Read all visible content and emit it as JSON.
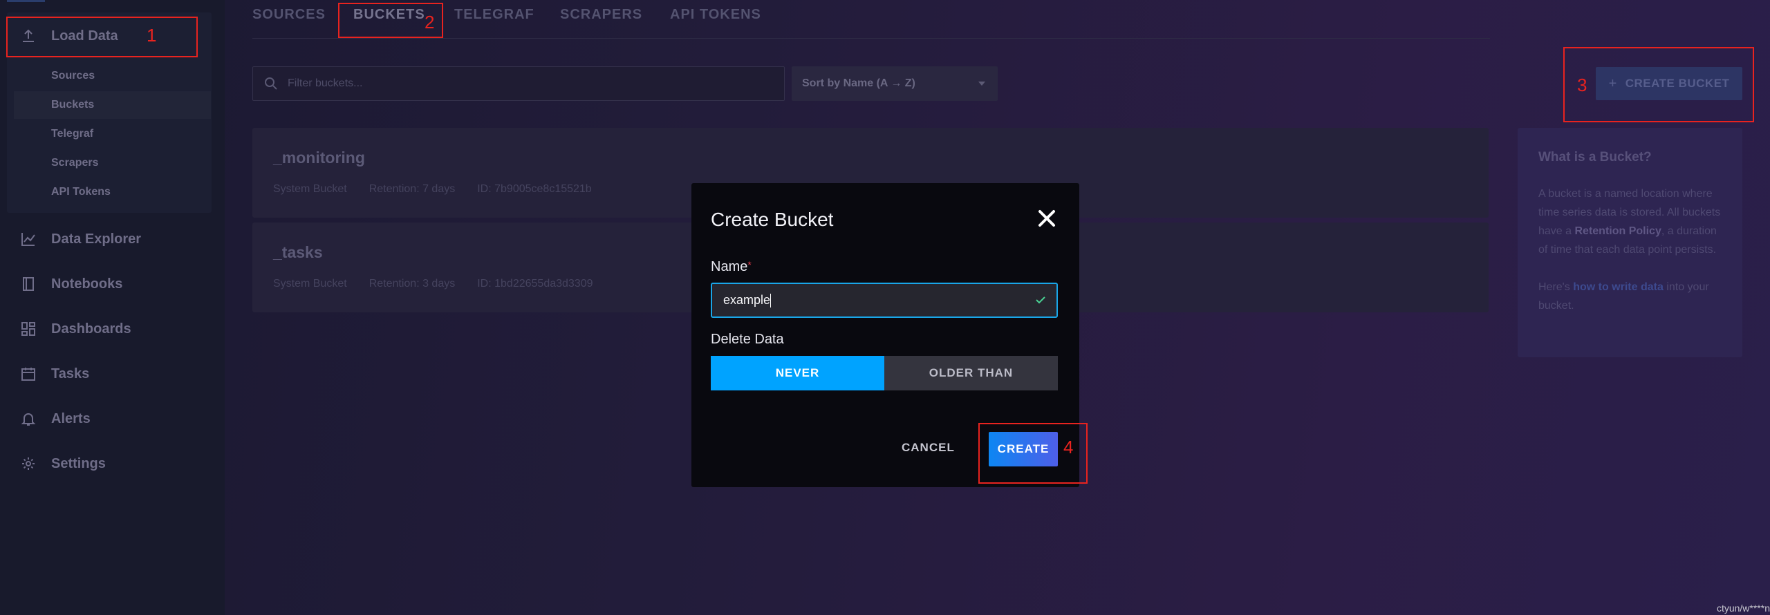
{
  "sidebar": {
    "load_data": "Load Data",
    "sub_items": [
      "Sources",
      "Buckets",
      "Telegraf",
      "Scrapers",
      "API Tokens"
    ],
    "nav": [
      {
        "label": "Data Explorer",
        "icon": "graph-icon"
      },
      {
        "label": "Notebooks",
        "icon": "book-icon"
      },
      {
        "label": "Dashboards",
        "icon": "grid-icon"
      },
      {
        "label": "Tasks",
        "icon": "calendar-icon"
      },
      {
        "label": "Alerts",
        "icon": "bell-icon"
      },
      {
        "label": "Settings",
        "icon": "gear-icon"
      }
    ]
  },
  "tabs": [
    "SOURCES",
    "BUCKETS",
    "TELEGRAF",
    "SCRAPERS",
    "API TOKENS"
  ],
  "active_tab": "BUCKETS",
  "filter": {
    "placeholder": "Filter buckets..."
  },
  "sort": {
    "value": "Sort by Name (A → Z)"
  },
  "create_bucket_label": "CREATE BUCKET",
  "buckets": [
    {
      "name": "_monitoring",
      "type": "System Bucket",
      "retention": "Retention: 7 days",
      "id": "ID: 7b9005ce8c15521b"
    },
    {
      "name": "_tasks",
      "type": "System Bucket",
      "retention": "Retention: 3 days",
      "id": "ID: 1bd22655da3d3309"
    }
  ],
  "info": {
    "title": "What is a Bucket?",
    "p1_a": "A bucket is a named location where time series data is stored. All buckets have a ",
    "p1_b": "Retention Policy",
    "p1_c": ", a duration of time that each data point persists.",
    "p2_a": "Here's ",
    "p2_link": "how to write data",
    "p2_b": " into your bucket."
  },
  "modal": {
    "title": "Create Bucket",
    "name_label": "Name",
    "required_mark": "*",
    "name_value": "example",
    "delete_label": "Delete Data",
    "options": [
      "NEVER",
      "OLDER THAN"
    ],
    "selected_option": "NEVER",
    "cancel_label": "CANCEL",
    "create_label": "CREATE"
  },
  "annotations": [
    "1",
    "2",
    "3",
    "4"
  ],
  "colors": {
    "accent": "#00a3ff",
    "annotation": "#e8231f",
    "create_start": "#0d86f2",
    "create_end": "#4e5fe9"
  },
  "watermark": "ctyun/w****n"
}
